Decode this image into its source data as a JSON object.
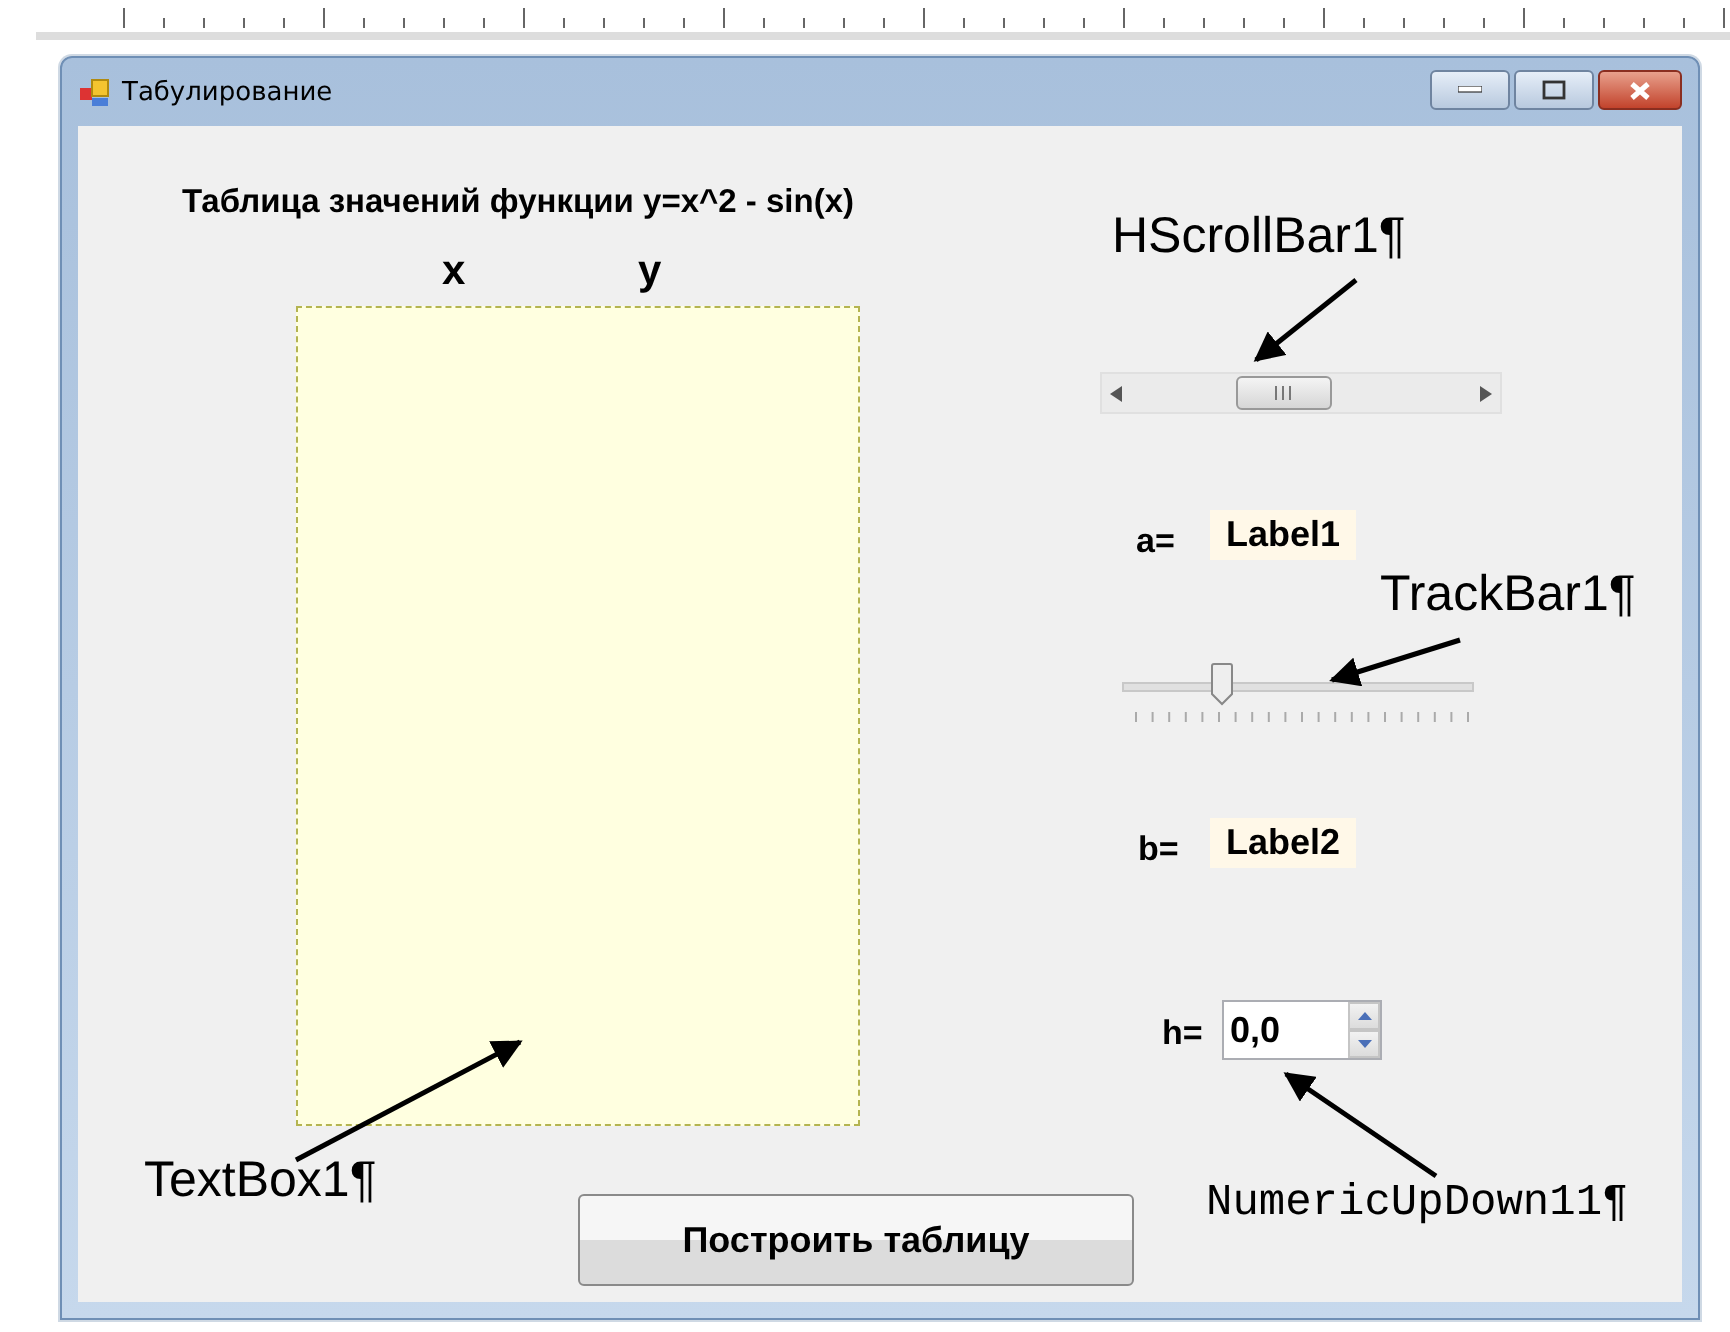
{
  "window": {
    "title": "Табулирование"
  },
  "form": {
    "heading": "Таблица значений функции y=x^2 - sin(x)",
    "column_headers": [
      "x",
      "y"
    ],
    "a_label": "a=",
    "label1": "Label1",
    "trackbar": {
      "level": 0.27
    },
    "b_label": "b=",
    "label2": "Label2",
    "h_label": "h=",
    "numeric": {
      "value": "0,0"
    },
    "button": "Построить таблицу"
  },
  "annotations": [
    {
      "text": "HScrollBar1¶",
      "kind": "sans"
    },
    {
      "text": "TrackBar1¶",
      "kind": "sans"
    },
    {
      "text": "TextBox1¶",
      "kind": "sans"
    },
    {
      "text": "NumericUpDown11¶",
      "kind": "mono"
    }
  ]
}
